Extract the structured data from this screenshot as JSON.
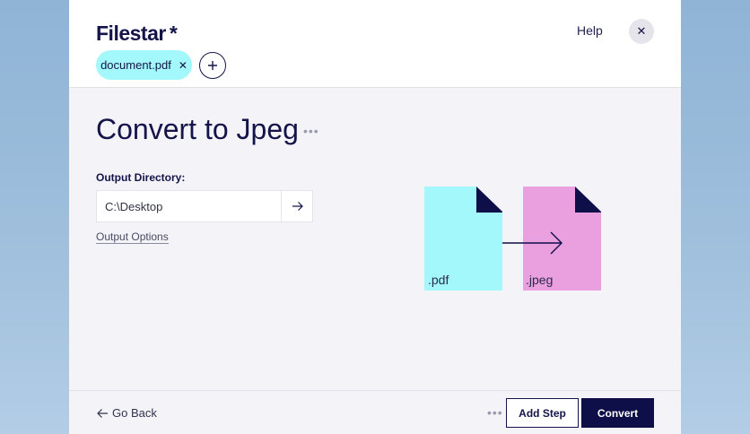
{
  "app": {
    "logo_text": "Filestar",
    "logo_star": "*",
    "help_label": "Help",
    "close_icon": "close-icon"
  },
  "files": [
    {
      "name": "document.pdf",
      "remove_icon": "close-icon"
    }
  ],
  "add_file_icon": "plus-icon",
  "main": {
    "title": "Convert to Jpeg",
    "title_more": "•••",
    "output_directory_label": "Output Directory:",
    "output_directory_value": "C:\\Desktop",
    "output_directory_go_icon": "arrow-right-icon",
    "output_options_label": "Output Options"
  },
  "illustration": {
    "source_label": ".pdf",
    "target_label": ".jpeg",
    "source_color": "#a3f8fb",
    "target_color": "#eaa0df",
    "ink_color": "#0e0e48"
  },
  "footer": {
    "go_back_label": "Go Back",
    "more": "•••",
    "add_step_label": "Add Step",
    "convert_label": "Convert"
  }
}
